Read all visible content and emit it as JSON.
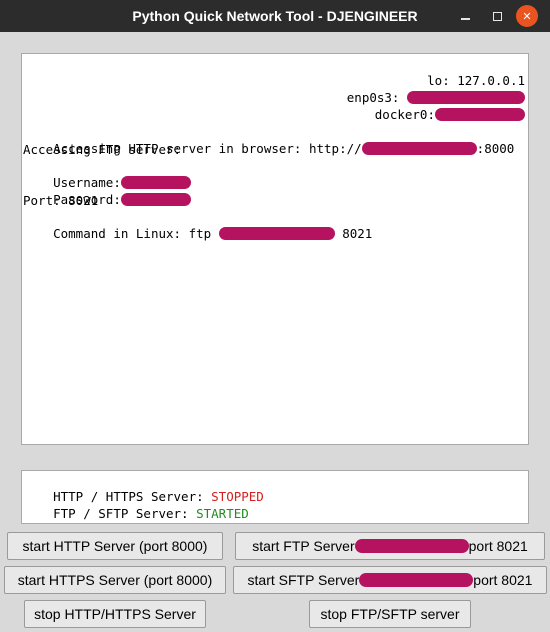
{
  "window": {
    "title": "Python Quick Network Tool - DJENGINEER",
    "min_glyph": "",
    "max_glyph": "",
    "close_glyph": "✕"
  },
  "output": {
    "lo_line": "lo: 127.0.0.1",
    "enp_label": "enp0s3: ",
    "docker_label": "docker0:",
    "http_prefix": "Accessing HTTP server in browser: http://",
    "http_suffix": ":8000",
    "ftp_heading": "Accessing FTP server:",
    "username_label": "Username:",
    "password_label": "Password:",
    "port_line": "Port: 8021",
    "cmd_prefix": "Command in Linux: ftp ",
    "cmd_suffix": " 8021"
  },
  "status": {
    "http_label": "HTTP / HTTPS Server: ",
    "http_state": "STOPPED",
    "ftp_label": "FTP / SFTP Server: ",
    "ftp_state": "STARTED"
  },
  "buttons": {
    "start_http": "start HTTP Server (port 8000)",
    "start_ftp_prefix": "start FTP Server",
    "start_ftp_suffix": " port 8021",
    "start_https": "start HTTPS Server (port 8000)",
    "start_sftp_prefix": "start SFTP Server",
    "start_sftp_suffix": " port 8021",
    "stop_http": "stop HTTP/HTTPS Server",
    "stop_ftp": "stop FTP/SFTP server"
  },
  "colors": {
    "redaction": "#b5135f",
    "stopped": "#d42020",
    "started": "#1f8c1f",
    "titlebar": "#2c2c2c",
    "close_button": "#e95420"
  }
}
